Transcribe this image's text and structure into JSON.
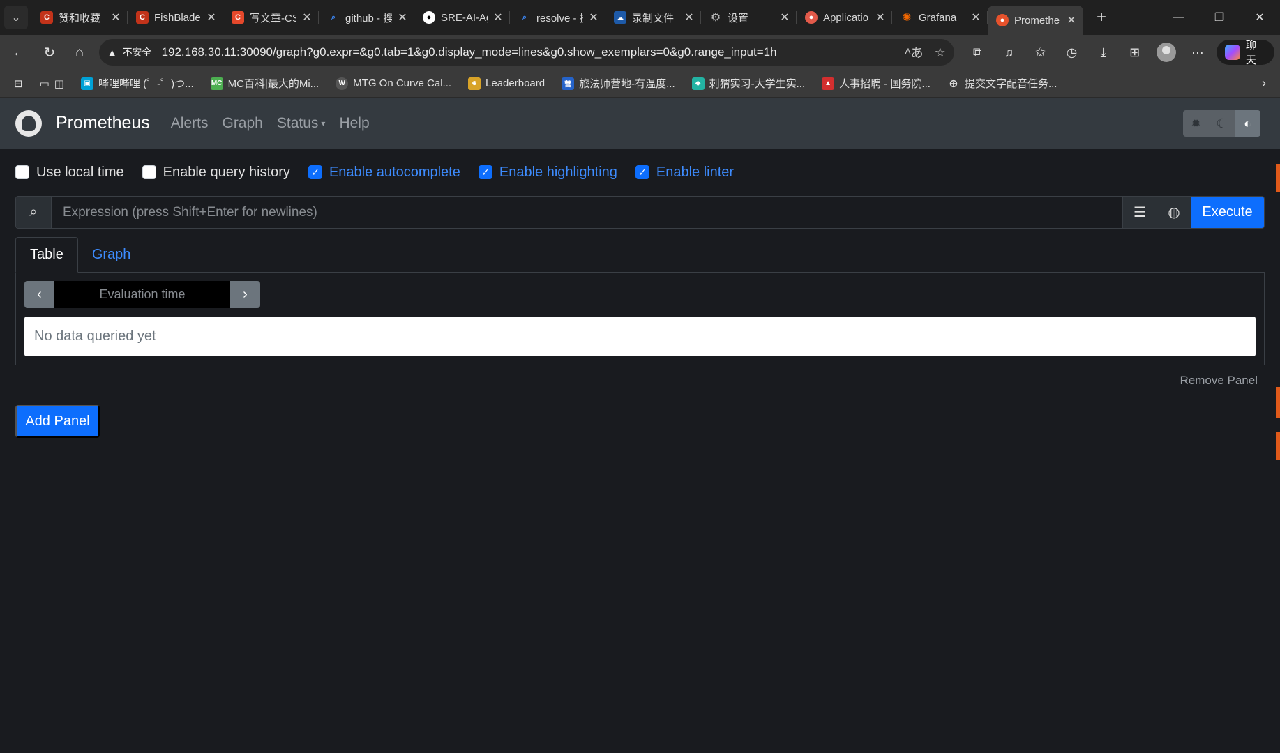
{
  "browser": {
    "tabs": [
      {
        "title": "赞和收藏",
        "favicon_color": "#c2331a",
        "favicon_text": "C"
      },
      {
        "title": "FishBlade",
        "favicon_color": "#c2331a",
        "favicon_text": "C"
      },
      {
        "title": "写文章-CS",
        "favicon_color": "#e5482b",
        "favicon_text": "C"
      },
      {
        "title": "github - 搜",
        "favicon_color": "#3a3a3a",
        "favicon_text": "🔍"
      },
      {
        "title": "SRE-AI-Ag",
        "favicon_color": "#202020",
        "favicon_text": "●"
      },
      {
        "title": "resolve - 搜",
        "favicon_color": "#3a3a3a",
        "favicon_text": "🔍"
      },
      {
        "title": "录制文件",
        "favicon_color": "#1e5aa8",
        "favicon_text": "☁"
      },
      {
        "title": "设置",
        "favicon_color": "#3a3a3a",
        "favicon_text": "⚙"
      },
      {
        "title": "Applicatio",
        "favicon_color": "#e25a4a",
        "favicon_text": "●"
      },
      {
        "title": "Grafana",
        "favicon_color": "#f46800",
        "favicon_text": "G"
      },
      {
        "title": "Promethe",
        "favicon_color": "#e6522c",
        "favicon_text": "P"
      }
    ],
    "insecure_label": "不安全",
    "url": "192.168.30.11:30090/graph?g0.expr=&g0.tab=1&g0.display_mode=lines&g0.show_exemplars=0&g0.range_input=1h",
    "copilot_label": "聊天",
    "bookmarks": [
      {
        "label": "",
        "color": "#3a3a3a",
        "icon": "📁"
      },
      {
        "label": "哔哩哔哩 (゜-゜)つ...",
        "color": "#00a1d6",
        "icon": "▣"
      },
      {
        "label": "MC百科|最大的Mi...",
        "color": "#4caf50",
        "icon": "MC"
      },
      {
        "label": "MTG On Curve Cal...",
        "color": "#555555",
        "icon": "W"
      },
      {
        "label": "Leaderboard",
        "color": "#d8a328",
        "icon": "☻"
      },
      {
        "label": "旅法师营地-有温度...",
        "color": "#2563c9",
        "icon": "营"
      },
      {
        "label": "刺猬实习-大学生实...",
        "color": "#23b3a3",
        "icon": "◆"
      },
      {
        "label": "人事招聘 - 国务院...",
        "color": "#d32f2f",
        "icon": "▲"
      },
      {
        "label": "提交文字配音任务...",
        "color": "#3a3a3a",
        "icon": "⊕"
      }
    ]
  },
  "app": {
    "brand": "Prometheus",
    "nav": [
      "Alerts",
      "Graph",
      "Status",
      "Help"
    ],
    "options": [
      {
        "label": "Use local time",
        "checked": false
      },
      {
        "label": "Enable query history",
        "checked": false
      },
      {
        "label": "Enable autocomplete",
        "checked": true
      },
      {
        "label": "Enable highlighting",
        "checked": true
      },
      {
        "label": "Enable linter",
        "checked": true
      }
    ],
    "expression_placeholder": "Expression (press Shift+Enter for newlines)",
    "execute_label": "Execute",
    "tabs": [
      "Table",
      "Graph"
    ],
    "evaluation_placeholder": "Evaluation time",
    "no_data": "No data queried yet",
    "remove_panel": "Remove Panel",
    "add_panel": "Add Panel"
  }
}
